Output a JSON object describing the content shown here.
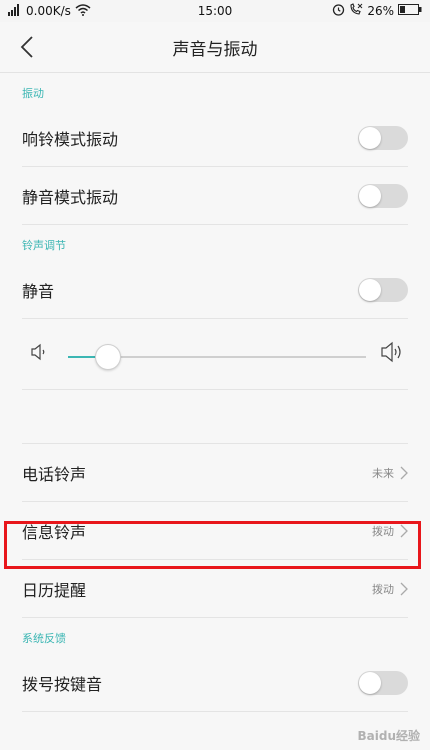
{
  "status_bar": {
    "network": "0.00K/s",
    "time": "15:00",
    "battery": "26%"
  },
  "header": {
    "title": "声音与振动"
  },
  "sections": {
    "vibration": {
      "title": "振动",
      "items": [
        {
          "label": "响铃模式振动",
          "enabled": false
        },
        {
          "label": "静音模式振动",
          "enabled": false
        }
      ]
    },
    "ringtone_adjust": {
      "title": "铃声调节",
      "mute_label": "静音",
      "mute_enabled": false,
      "volume_level": 0.13
    },
    "ringtones": [
      {
        "label": "电话铃声",
        "value": "未来"
      },
      {
        "label": "信息铃声",
        "value": "拨动"
      },
      {
        "label": "日历提醒",
        "value": "拨动"
      }
    ],
    "feedback": {
      "title": "系统反馈",
      "items": [
        {
          "label": "拨号按键音",
          "enabled": false
        }
      ]
    }
  },
  "watermark": "Baidu经验",
  "colors": {
    "accent": "#3bb6b3",
    "highlight": "#e8161b"
  }
}
